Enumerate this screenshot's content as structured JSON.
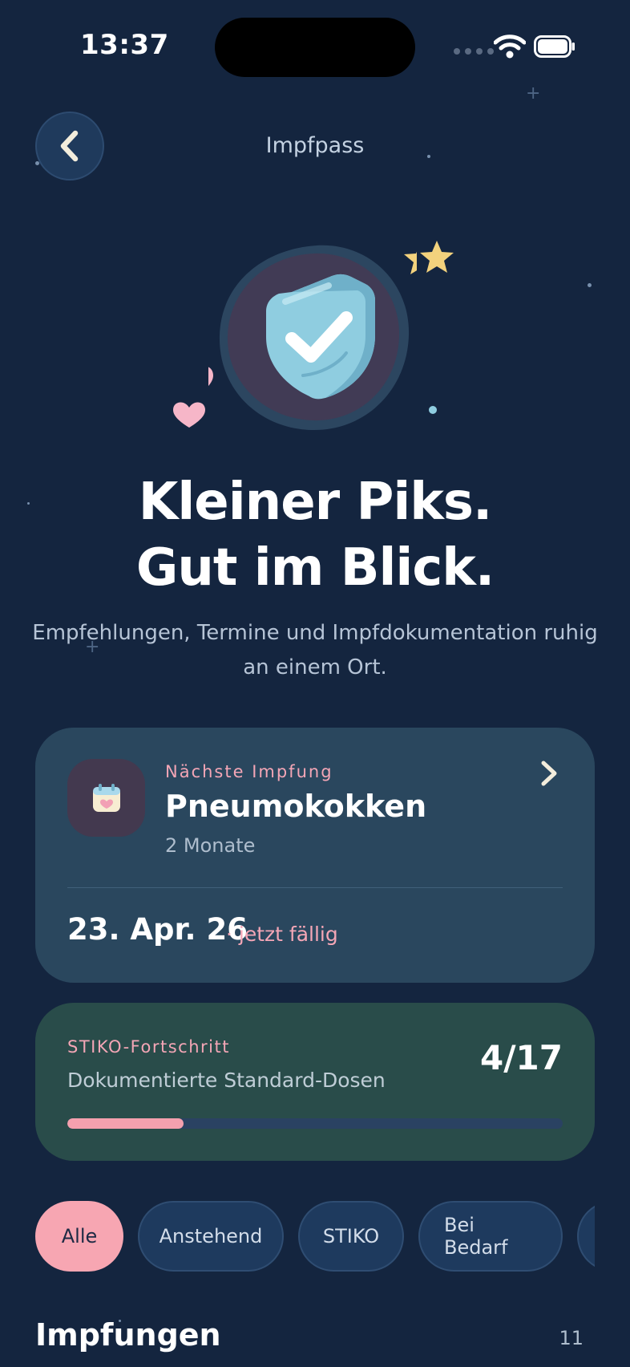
{
  "status_bar": {
    "time": "13:37",
    "icons": [
      "signal-icon",
      "wifi-icon",
      "battery-icon"
    ]
  },
  "header": {
    "back_icon": "chevron-left-icon",
    "title": "Impfpass"
  },
  "hero": {
    "illustration": "shield-check-icon",
    "headline_line1": "Kleiner Piks.",
    "headline_line2": "Gut im Blick.",
    "subtitle": "Empfehlungen, Termine und Impfdokumentation ruhig an einem Ort."
  },
  "next_vaccination": {
    "icon": "calendar-heart-icon",
    "label": "Nächste Impfung",
    "name": "Pneumokokken",
    "age": "2 Monate",
    "date": "23. Apr. 26",
    "due": "· jetzt fällig",
    "chevron_icon": "chevron-right-icon"
  },
  "progress": {
    "label": "STIKO-Fortschritt",
    "description": "Dokumentierte Standard-Dosen",
    "count": "4/17",
    "documented": 4,
    "total": 17
  },
  "filters": [
    {
      "label": "Alle",
      "active": true
    },
    {
      "label": "Anstehend",
      "active": false
    },
    {
      "label": "STIKO",
      "active": false
    },
    {
      "label": "Bei Bedarf",
      "active": false
    },
    {
      "label": "",
      "active": false
    }
  ],
  "section": {
    "title": "Impfungen",
    "count": "11"
  },
  "colors": {
    "background": "#14253f",
    "accent_pink": "#f4a6b6",
    "card_blue": "#2a475e",
    "card_green": "#294c4a"
  }
}
